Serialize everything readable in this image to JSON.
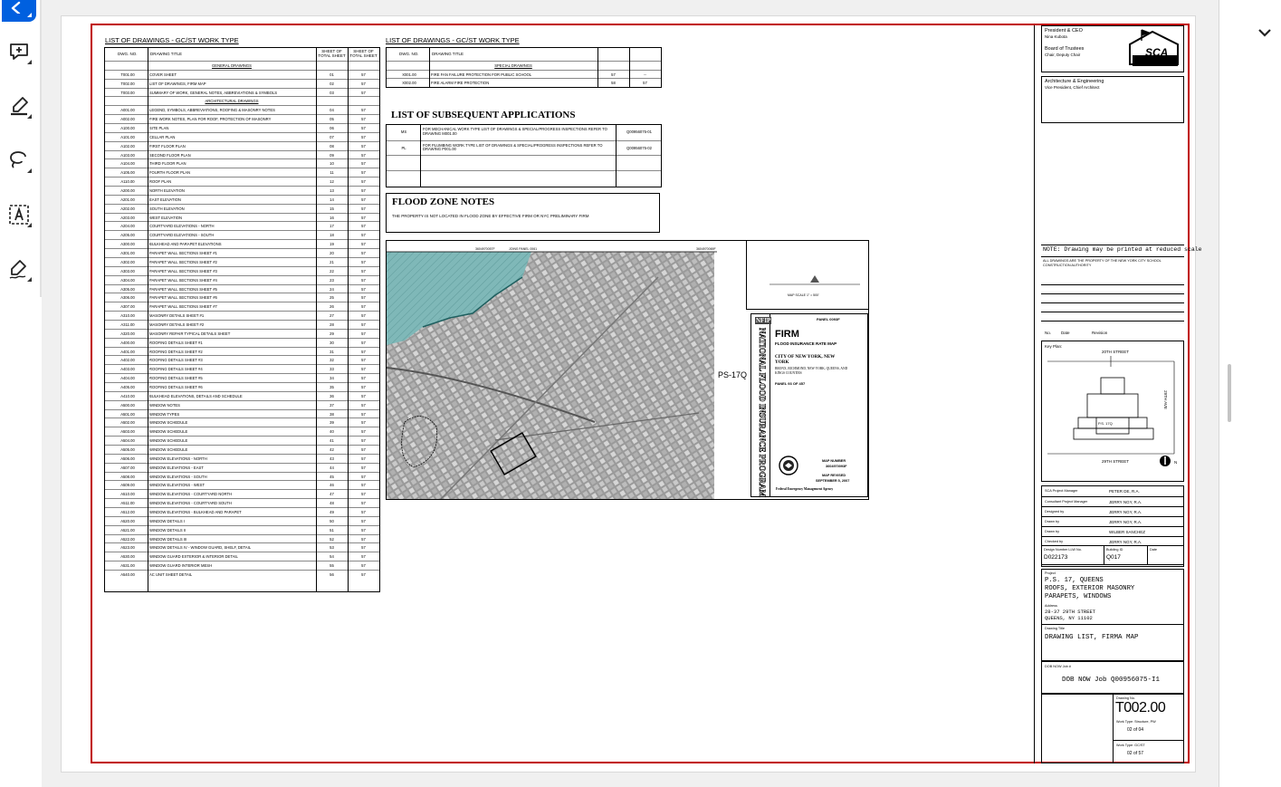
{
  "tools": [
    {
      "name": "select-tool",
      "icon": "pointer-icon"
    },
    {
      "name": "add-comment-tool",
      "icon": "comment-plus-icon"
    },
    {
      "name": "highlight-tool",
      "icon": "highlighter-icon"
    },
    {
      "name": "draw-tool",
      "icon": "lasso-icon"
    },
    {
      "name": "add-text-tool",
      "icon": "text-box-icon"
    },
    {
      "name": "sign-tool",
      "icon": "pen-sign-icon"
    }
  ],
  "colors": {
    "accent": "#0060df",
    "sheet_border": "#c00000",
    "flood": "#7fb8b8"
  },
  "left_table": {
    "title": "LIST OF DRAWINGS - GC/ST WORK TYPE",
    "headers": {
      "dwg_no": "DWG. NO.",
      "title": "DRAWING TITLE",
      "sheet_total": "SHEET OF TOTAL SHEET",
      "sheet_of": "SHEET OF TOTAL SHEET"
    },
    "rows": [
      {
        "no": "",
        "title": "GENERAL DRAWINGS",
        "a": "",
        "b": ""
      },
      {
        "no": "T001.00",
        "title": "COVER SHEET",
        "a": "01",
        "b": "57"
      },
      {
        "no": "T002.00",
        "title": "LIST OF DRAWINGS, FIRM MAP",
        "a": "02",
        "b": "57"
      },
      {
        "no": "T003.00",
        "title": "SUMMARY OF WORK, GENERAL NOTES, ABBREVIATIONS & SYMBOLS",
        "a": "03",
        "b": "57"
      },
      {
        "no": "",
        "title": "ARCHITECTURAL DRAWINGS",
        "a": "",
        "b": ""
      },
      {
        "no": "A001.00",
        "title": "LEGEND, SYMBOLS, ABBREVIATIONS, ROOFING & MASONRY NOTES",
        "a": "04",
        "b": "57"
      },
      {
        "no": "A002.00",
        "title": "FIRE WORK NOTES, PLAN FOR ROOF, PROTECTION OF MASONRY",
        "a": "05",
        "b": "57"
      },
      {
        "no": "A100.00",
        "title": "SITE PLAN",
        "a": "06",
        "b": "57"
      },
      {
        "no": "A101.00",
        "title": "CELLAR PLAN",
        "a": "07",
        "b": "57"
      },
      {
        "no": "A102.00",
        "title": "FIRST FLOOR PLAN",
        "a": "08",
        "b": "57"
      },
      {
        "no": "A103.00",
        "title": "SECOND FLOOR PLAN",
        "a": "09",
        "b": "57"
      },
      {
        "no": "A104.00",
        "title": "THIRD FLOOR PLAN",
        "a": "10",
        "b": "57"
      },
      {
        "no": "A105.00",
        "title": "FOURTH FLOOR PLAN",
        "a": "11",
        "b": "57"
      },
      {
        "no": "A110.00",
        "title": "ROOF PLAN",
        "a": "12",
        "b": "57"
      },
      {
        "no": "A200.00",
        "title": "NORTH ELEVATION",
        "a": "13",
        "b": "57"
      },
      {
        "no": "A201.00",
        "title": "EAST ELEVATION",
        "a": "14",
        "b": "57"
      },
      {
        "no": "A202.00",
        "title": "SOUTH ELEVATION",
        "a": "15",
        "b": "57"
      },
      {
        "no": "A203.00",
        "title": "WEST ELEVATION",
        "a": "16",
        "b": "57"
      },
      {
        "no": "A204.00",
        "title": "COURTYARD ELEVATIONS - NORTH",
        "a": "17",
        "b": "57"
      },
      {
        "no": "A205.00",
        "title": "COURTYARD ELEVATIONS - SOUTH",
        "a": "18",
        "b": "57"
      },
      {
        "no": "A300.00",
        "title": "BULKHEAD AND PARAPET ELEVATIONS",
        "a": "19",
        "b": "57"
      },
      {
        "no": "A301.00",
        "title": "PARAPET WALL SECTIONS SHEET #1",
        "a": "20",
        "b": "57"
      },
      {
        "no": "A302.00",
        "title": "PARAPET WALL SECTIONS SHEET #2",
        "a": "21",
        "b": "57"
      },
      {
        "no": "A303.00",
        "title": "PARAPET WALL SECTIONS SHEET #3",
        "a": "22",
        "b": "57"
      },
      {
        "no": "A304.00",
        "title": "PARAPET WALL SECTIONS SHEET #4",
        "a": "23",
        "b": "57"
      },
      {
        "no": "A305.00",
        "title": "PARAPET WALL SECTIONS SHEET #5",
        "a": "24",
        "b": "57"
      },
      {
        "no": "A306.00",
        "title": "PARAPET WALL SECTIONS SHEET #6",
        "a": "25",
        "b": "57"
      },
      {
        "no": "A307.00",
        "title": "PARAPET WALL SECTIONS SHEET #7",
        "a": "26",
        "b": "57"
      },
      {
        "no": "A310.00",
        "title": "MASONRY DETAILS SHEET #1",
        "a": "27",
        "b": "57"
      },
      {
        "no": "A311.00",
        "title": "MASONRY DETAILS SHEET #2",
        "a": "28",
        "b": "57"
      },
      {
        "no": "A320.00",
        "title": "MASONRY REPAIR TYPICAL DETAILS SHEET",
        "a": "29",
        "b": "57"
      },
      {
        "no": "A400.00",
        "title": "ROOFING DETAILS SHEET #1",
        "a": "30",
        "b": "57"
      },
      {
        "no": "A401.00",
        "title": "ROOFING DETAILS SHEET #2",
        "a": "31",
        "b": "57"
      },
      {
        "no": "A402.00",
        "title": "ROOFING DETAILS SHEET #3",
        "a": "32",
        "b": "57"
      },
      {
        "no": "A403.00",
        "title": "ROOFING DETAILS SHEET #4",
        "a": "33",
        "b": "57"
      },
      {
        "no": "A404.00",
        "title": "ROOFING DETAILS SHEET #5",
        "a": "34",
        "b": "57"
      },
      {
        "no": "A405.00",
        "title": "ROOFING DETAILS SHEET #6",
        "a": "35",
        "b": "57"
      },
      {
        "no": "A410.00",
        "title": "BULKHEAD ELEVATIONS, DETAILS AND SCHEDULE",
        "a": "36",
        "b": "57"
      },
      {
        "no": "A500.00",
        "title": "WINDOW NOTES",
        "a": "37",
        "b": "57"
      },
      {
        "no": "A501.00",
        "title": "WINDOW TYPES",
        "a": "38",
        "b": "57"
      },
      {
        "no": "A502.00",
        "title": "WINDOW SCHEDULE",
        "a": "39",
        "b": "57"
      },
      {
        "no": "A503.00",
        "title": "WINDOW SCHEDULE",
        "a": "40",
        "b": "57"
      },
      {
        "no": "A504.00",
        "title": "WINDOW SCHEDULE",
        "a": "41",
        "b": "57"
      },
      {
        "no": "A505.00",
        "title": "WINDOW SCHEDULE",
        "a": "42",
        "b": "57"
      },
      {
        "no": "A506.00",
        "title": "WINDOW ELEVATIONS - NORTH",
        "a": "43",
        "b": "57"
      },
      {
        "no": "A507.00",
        "title": "WINDOW ELEVATIONS - EAST",
        "a": "44",
        "b": "57"
      },
      {
        "no": "A508.00",
        "title": "WINDOW ELEVATIONS - SOUTH",
        "a": "45",
        "b": "57"
      },
      {
        "no": "A509.00",
        "title": "WINDOW ELEVATIONS - WEST",
        "a": "46",
        "b": "57"
      },
      {
        "no": "A510.00",
        "title": "WINDOW ELEVATIONS - COURTYARD NORTH",
        "a": "47",
        "b": "57"
      },
      {
        "no": "A511.00",
        "title": "WINDOW ELEVATIONS - COURTYARD SOUTH",
        "a": "48",
        "b": "57"
      },
      {
        "no": "A512.00",
        "title": "WINDOW ELEVATIONS - BULKHEAD AND PARAPET",
        "a": "49",
        "b": "57"
      },
      {
        "no": "A520.00",
        "title": "WINDOW DETAILS I",
        "a": "50",
        "b": "57"
      },
      {
        "no": "A521.00",
        "title": "WINDOW DETAILS II",
        "a": "51",
        "b": "57"
      },
      {
        "no": "A522.00",
        "title": "WINDOW DETAILS III",
        "a": "52",
        "b": "57"
      },
      {
        "no": "A523.00",
        "title": "WINDOW DETAILS IV - WINDOW GUARD, SHELF, DETAIL",
        "a": "53",
        "b": "57"
      },
      {
        "no": "A530.00",
        "title": "WINDOW GUARD EXTERIOR & INTERIOR DETAIL",
        "a": "54",
        "b": "57"
      },
      {
        "no": "A531.00",
        "title": "WINDOW GUARD INTERIOR MESH",
        "a": "55",
        "b": "57"
      },
      {
        "no": "A540.00",
        "title": "AC UNIT SHEET DETAIL",
        "a": "56",
        "b": "57"
      }
    ]
  },
  "right_table": {
    "title": "LIST OF DRAWINGS - GC/ST WORK TYPE",
    "rows": [
      {
        "no": "",
        "title": "SPECIAL DRAWINGS",
        "a": "",
        "b": ""
      },
      {
        "no": "X001.00",
        "title": "FIRE FAN FAILURE PROTECTION FOR PUBLIC SCHOOL",
        "a": "57",
        "b": "--"
      },
      {
        "no": "X002.00",
        "title": "FIRE ALARM FIRE PROTECTION",
        "a": "58",
        "b": "57"
      }
    ]
  },
  "subsequent": {
    "title": "LIST OF SUBSEQUENT APPLICATIONS",
    "rows": [
      {
        "code": "MS",
        "desc": "FOR MECHANICAL WORK TYPE LIST OF DRAWINGS & SPECIAL/PROGRESS INSPECTIONS REFER TO DRAWING M001.00",
        "num": "Q00956075-01"
      },
      {
        "code": "PL",
        "desc": "FOR PLUMBING WORK TYPE LIST OF DRAWINGS & SPECIAL/PROGRESS INSPECTIONS REFER TO DRAWING P001.00",
        "num": "Q00956075-02"
      },
      {
        "code": "",
        "desc": "",
        "num": ""
      },
      {
        "code": "",
        "desc": "",
        "num": ""
      }
    ]
  },
  "flood": {
    "title": "FLOOD ZONE NOTES",
    "text": "THE PROPERTY IS NOT LOCATED IN FLOOD ZONE BY EFFECTIVE FIRM OR NYC PRELIMINARY FIRM"
  },
  "map": {
    "site_label": "PS-17Q",
    "panel_top_left": "3604970057F",
    "panel_top_mid": "JOINS PANEL 0061",
    "panel_top_right": "3604970069F",
    "street_1": "20TH STREET",
    "street_2": "29TH STREET",
    "nfip": "NFIP",
    "panel": "PANEL 0093F",
    "firm": "FIRM",
    "firm_sub": "FLOOD INSURANCE RATE MAP",
    "city": "CITY OF NEW YORK, NEW YORK",
    "boroughs": "BRONX, RICHMOND, NEW YORK, QUEENS, AND KINGS COUNTIES",
    "panel_no": "PANEL 93 OF 457",
    "map_number_label": "MAP NUMBER",
    "map_number": "3604970093F",
    "revised_label": "MAP REVISED",
    "revised": "SEPTEMBER 5, 2007",
    "agency": "Federal Emergency Management Agency",
    "vertical": "NATIONAL FLOOD INSURANCE PROGRAM",
    "scale": "MAP SCALE 1\" = 500'"
  },
  "titleblock": {
    "president_label": "President & CEO",
    "president": "Nina Kubota",
    "board_label": "Board of Trustees",
    "board": "Chair, Deputy Chair",
    "logo": "SCA",
    "arch_label": "Architecture & Engineering",
    "arch": "Vice President, Chief Architect",
    "note": "NOTE: Drawing may be printed at reduced scale",
    "note_body": "ALL DRAWINGS ARE THE PROPERTY OF THE NEW YORK CITY SCHOOL CONSTRUCTION AUTHORITY",
    "rev_no": "No.",
    "rev_date": "Date",
    "rev_rev": "Revision",
    "key_plan": "Key Plan:",
    "kp_top": "20TH STREET",
    "kp_bottom": "29TH STREET",
    "kp_right": "29TH AVE",
    "kp_building": "P.S. 17Q",
    "north": "N",
    "roles": [
      {
        "label": "SCA Project Manager",
        "value": "PETER DE, R.A."
      },
      {
        "label": "Consultant Project Manager",
        "value": "JERRY NGY, R.A."
      },
      {
        "label": "Designed by",
        "value": "JERRY NGY, R.A."
      },
      {
        "label": "Drawn by",
        "value": "JERRY NGY, R.A."
      },
      {
        "label": "Drawn by",
        "value": "WILBER SANCHEZ"
      },
      {
        "label": "Checked by",
        "value": "JERRY NGY, R.A."
      }
    ],
    "design_no_label": "Design Number LLW No.",
    "design_no": "D022173",
    "building_label": "Building ID",
    "building": "Q017",
    "date_label": "Date",
    "project_label": "Project",
    "project_l1": "P.S. 17, QUEENS",
    "project_l2": "ROOFS, EXTERIOR MASONRY",
    "project_l3": "PARAPETS, WINDOWS",
    "address_label": "Address",
    "address_l1": "28-37 29TH STREET",
    "address_l2": "QUEENS, NY 11102",
    "dwg_title_label": "Drawing Title",
    "dwg_title": "DRAWING LIST, FIRMA MAP",
    "dob_label": "DOB NOW Job #",
    "dob": "DOB NOW Job Q00956075-I1",
    "dwg_no_label": "Drawing No.",
    "dwg_no": "T002.00",
    "sheet_info_1": "Work Type: Structure, PW",
    "sheet_info_2": "02 of 04",
    "sheet_info_3": "Work Type: GC/ST",
    "sheet_info_4": "02 of 57"
  }
}
